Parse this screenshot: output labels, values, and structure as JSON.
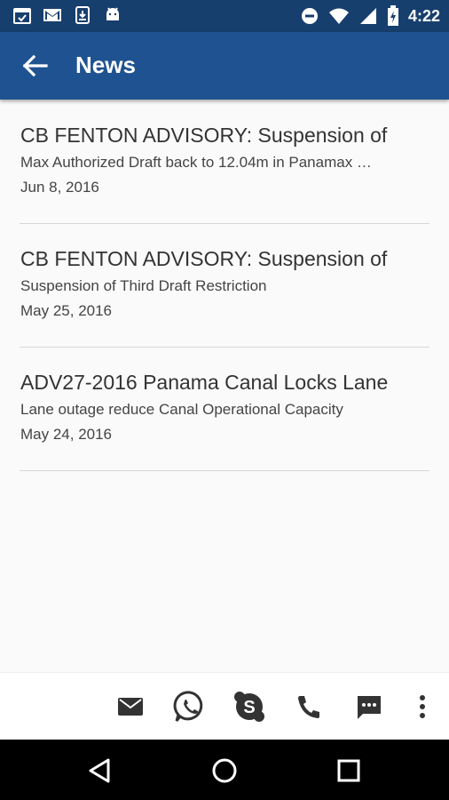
{
  "status_bar": {
    "time": "4:22",
    "left_icons": [
      "calendar-icon",
      "gmail-icon",
      "download-icon",
      "android-icon"
    ],
    "right_icons": [
      "do-not-disturb-icon",
      "wifi-icon",
      "signal-icon",
      "battery-charging-icon"
    ]
  },
  "app_bar": {
    "title": "News",
    "back_icon": "arrow-back-icon"
  },
  "news": [
    {
      "title": "CB FENTON ADVISORY: Suspension of",
      "summary": "Max Authorized Draft back to 12.04m in Panamax …",
      "date": "Jun 8, 2016"
    },
    {
      "title": "CB FENTON ADVISORY: Suspension of",
      "summary": "Suspension of Third Draft Restriction",
      "date": "May 25, 2016"
    },
    {
      "title": "ADV27-2016  Panama Canal Locks Lane",
      "summary": "Lane outage reduce Canal Operational Capacity",
      "date": "May 24, 2016"
    }
  ],
  "bottom_actions": [
    "email-icon",
    "whatsapp-icon",
    "skype-icon",
    "phone-icon",
    "sms-icon",
    "more-vert-icon"
  ],
  "nav": [
    "back-triangle-icon",
    "home-circle-icon",
    "recents-square-icon"
  ],
  "colors": {
    "status_bar": "#173f6e",
    "app_bar": "#1f5290",
    "background": "#fafafa",
    "divider": "#d6d6d6"
  }
}
